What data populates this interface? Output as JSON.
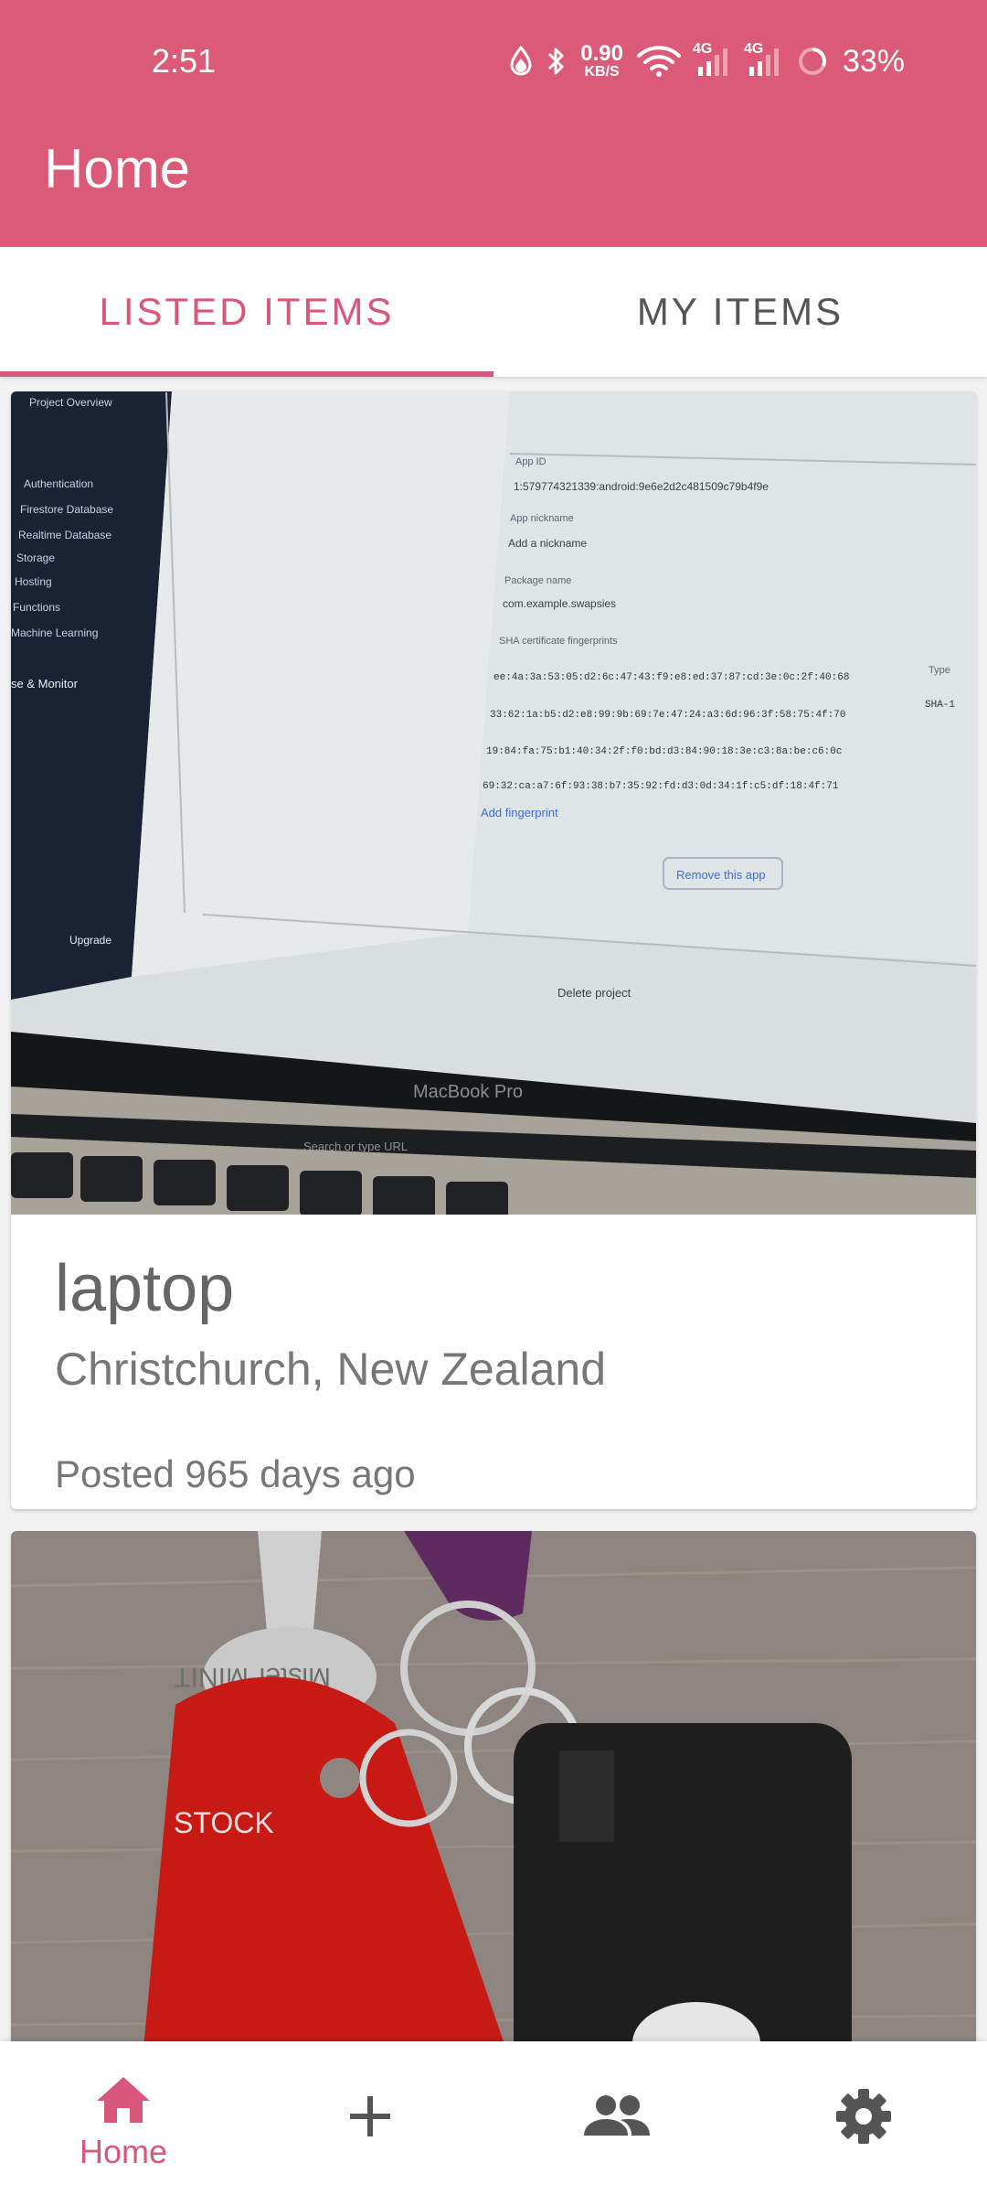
{
  "status_bar": {
    "time": "2:51",
    "net_speed_value": "0.90",
    "net_speed_unit": "KB/S",
    "network_1": "4G",
    "network_2": "4G",
    "battery": "33%"
  },
  "app_bar": {
    "title": "Home"
  },
  "tabs": [
    {
      "label": "LISTED ITEMS",
      "selected": true
    },
    {
      "label": "MY ITEMS",
      "selected": false
    }
  ],
  "listings": [
    {
      "title": "laptop",
      "location": "Christchurch, New Zealand",
      "posted": "Posted 965 days ago"
    },
    {
      "title": "",
      "location": "",
      "posted": ""
    }
  ],
  "photo_text": {
    "project_overview": "Project Overview",
    "authentication": "Authentication",
    "firestore": "Firestore Database",
    "realtime": "Realtime Database",
    "storage": "Storage",
    "hosting": "Hosting",
    "functions": "Functions",
    "ml": "Machine Learning",
    "monitor": "se & Monitor",
    "upgrade": "Upgrade",
    "app_id_label": "App ID",
    "app_id": "1:579774321339:android:9e6e2d2c481509c79b4f9e",
    "nickname_label": "App nickname",
    "nickname": "Add a nickname",
    "package_label": "Package name",
    "package": "com.example.swapsies",
    "sha_label": "SHA certificate fingerprints",
    "type_label": "Type",
    "sha1": "ee:4a:3a:53:05:d2:6c:47:43:f9:e8:ed:37:87:cd:3e:0c:2f:40:68",
    "sha2": "33:62:1a:b5:d2:e8:99:9b:69:7e:47:24:a3:6d:96:3f:58:75:4f:70",
    "sha3": "19:84:fa:75:b1:40:34:2f:f0:bd:d3:84:90:18:3e:c3:8a:be:c6:0c",
    "sha4": "69:32:ca:a7:6f:93:38:b7:35:92:fd:d3:0d:34:1f:c5:df:18:4f:71",
    "sha_type": "SHA-1",
    "add_fingerprint": "Add fingerprint",
    "remove_app": "Remove this app",
    "delete_project": "Delete project",
    "macbook": "MacBook Pro",
    "search_hint": "Search or type URL",
    "keytag_brand": "Mister MINIT",
    "keytag_text": "STOCK"
  },
  "bottom_nav": [
    {
      "label": "Home",
      "icon": "home-icon",
      "active": true
    },
    {
      "label": "",
      "icon": "add-icon",
      "active": false
    },
    {
      "label": "",
      "icon": "people-icon",
      "active": false
    },
    {
      "label": "",
      "icon": "settings-icon",
      "active": false
    }
  ],
  "colors": {
    "primary": "#db5a77",
    "accent": "#d7587a",
    "inactive_icon": "#555555"
  }
}
